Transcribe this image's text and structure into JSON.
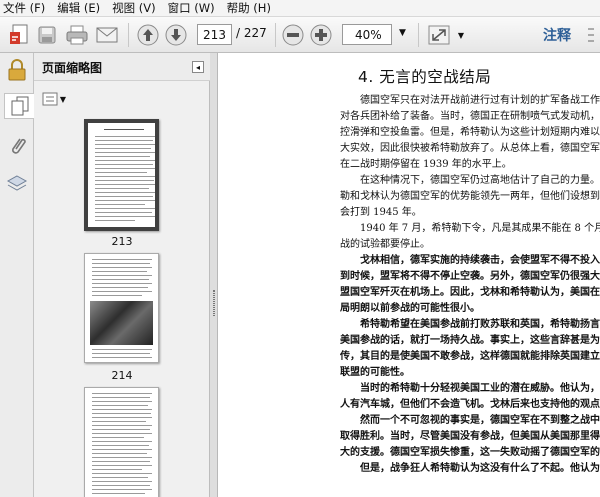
{
  "menu": [
    "文件 (F)",
    "编辑 (E)",
    "视图 (V)",
    "窗口 (W)",
    "帮助 (H)"
  ],
  "toolbar": {
    "page_current": "213",
    "page_total": "/ 227",
    "zoom": "40%",
    "annotate_label": "注释"
  },
  "panel": {
    "title": "页面缩略图",
    "close_glyph": "◂"
  },
  "thumbnails": [
    {
      "label": "213"
    },
    {
      "label": "214"
    }
  ],
  "document": {
    "chapter_title": "4. 无言的空战结局",
    "paragraphs": [
      [
        "德国空军只在对法开战前进行过有计划的扩军备战工作，并",
        "对各兵团补给了装备。当时，德国正在研制喷气式发动机，以及可",
        "控滑弹和空投鱼雷。但是，希特勒认为这些计划短期内难以产生很",
        "大实效，因此很快被希特勒放弃了。从总体上看，德国空军的装备",
        "在二战时期停留在 1939 年的水平上。"
      ],
      [
        "在这种情况下，德国空军仍过高地估计了自己的力量。希特",
        "勒和戈林认为德国空军的优势能领先一两年，但他们设想到战争",
        "会打到 1945 年。"
      ],
      [
        "1940 年 7 月，希特勒下令，凡是其成果不能在 8 个月内用于作",
        "战的试验都要停止。"
      ],
      [
        "戈林相信，德军实施的持续袭击，会使盟军不得不投入重大的损失，",
        "到时候，盟军将不得不停止空袭。另外，德国空军仍很强大，能把",
        "盟国空军歼灭在机场上。因此，戈林和希特勒认为，美国在战争结",
        "局明朗以前参战的可能性很小。"
      ],
      [
        "希特勒希望在美国参战前打败苏联和英国，希特勒扬言，如果",
        "美国参战的话，就打一场持久战。事实上，这些言辞甚是为了宣",
        "传，其目的是使美国不敢参战，这样德国就能排除英国建立强大的",
        "联盟的可能性。"
      ],
      [
        "当时的希特勒十分轻视美国工业的潜在威胁。他认为，美国",
        "人有汽车城，但他们不会造飞机。戈林后来也支持他的观点。"
      ],
      [
        "然而一个不可忽视的事实是，德国空军在不到整之战中没有",
        "取得胜利。当时，尽管美国没有参战，但美国从美国那里得到了强",
        "大的支援。德国空军损失惨重，这一失败动摇了德国空军的优势。"
      ],
      [
        "但是，战争狂人希特勒认为这没有什么了不起。他认为通过"
      ]
    ]
  }
}
